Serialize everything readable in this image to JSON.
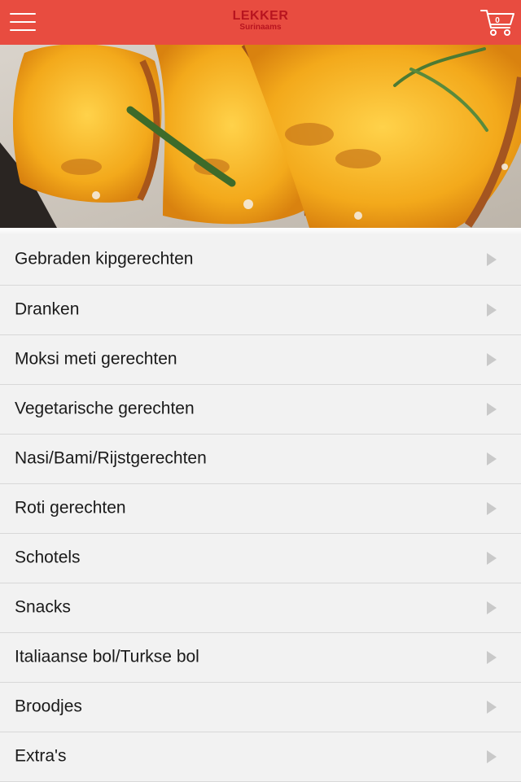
{
  "header": {
    "menu_icon": "hamburger-menu-icon",
    "logo_main": "LEKKER",
    "logo_sub": "Surinaams",
    "cart_icon": "shopping-cart-icon",
    "cart_count": "0",
    "background_color": "#e84c40",
    "logo_color": "#b8141f"
  },
  "hero": {
    "image_subject": "roasted pumpkin slices with rosemary"
  },
  "menu": {
    "arrow_icon": "chevron-right-icon",
    "items": [
      {
        "label": "Gebraden kipgerechten"
      },
      {
        "label": "Dranken"
      },
      {
        "label": "Moksi meti gerechten"
      },
      {
        "label": "Vegetarische gerechten"
      },
      {
        "label": "Nasi/Bami/Rijstgerechten"
      },
      {
        "label": "Roti gerechten"
      },
      {
        "label": "Schotels"
      },
      {
        "label": "Snacks"
      },
      {
        "label": "Italiaanse bol/Turkse bol"
      },
      {
        "label": "Broodjes"
      },
      {
        "label": "Extra's"
      }
    ]
  }
}
